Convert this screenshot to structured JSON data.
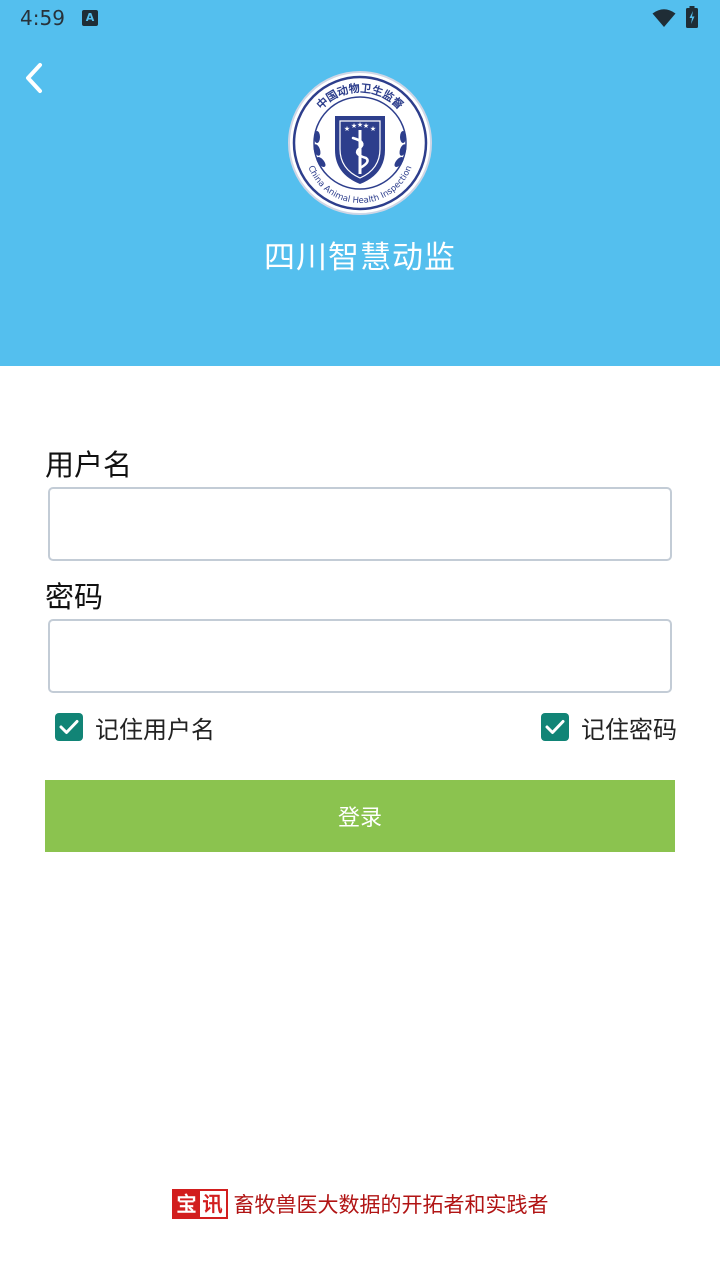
{
  "status_bar": {
    "time": "4:59",
    "notification_icon": "a-notification-icon",
    "wifi_icon": "wifi-icon",
    "battery_icon": "battery-charging-icon"
  },
  "header": {
    "back_icon": "chevron-left-icon",
    "logo_text_cn": "中国动物卫生监督",
    "logo_text_en": "China Animal Health Inspection",
    "app_title": "四川智慧动监",
    "background_color": "#54bfee"
  },
  "form": {
    "username_label": "用户名",
    "username_value": "",
    "password_label": "密码",
    "password_value": "",
    "remember_username_label": "记住用户名",
    "remember_username_checked": true,
    "remember_password_label": "记住密码",
    "remember_password_checked": true,
    "login_label": "登录",
    "login_color": "#8bc34f",
    "checkbox_color": "#118476"
  },
  "footer": {
    "brand_char_1": "宝",
    "brand_char_2": "讯",
    "slogan": "畜牧兽医大数据的开拓者和实践者",
    "slogan_color": "#b11414"
  }
}
